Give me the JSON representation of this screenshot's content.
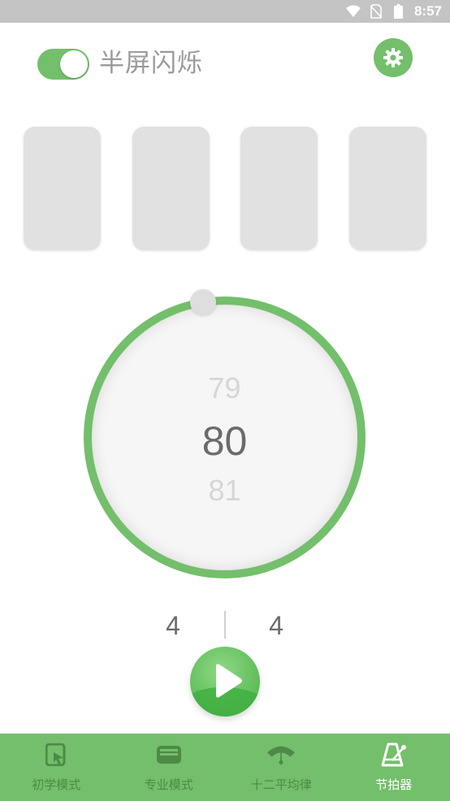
{
  "status_bar": {
    "time": "8:57",
    "icons": [
      "wifi-icon",
      "no-sim-icon",
      "battery-icon"
    ]
  },
  "header": {
    "flash_toggle_on": true,
    "flash_label": "半屏闪烁",
    "settings_icon": "gear-icon"
  },
  "beats": [
    {
      "active": false
    },
    {
      "active": false
    },
    {
      "active": false
    },
    {
      "active": false
    }
  ],
  "tempo": {
    "previous": "79",
    "current": "80",
    "next": "81"
  },
  "time_signature": {
    "beats_per_bar": "4",
    "note_value": "4"
  },
  "play_button": {
    "icon": "play-icon"
  },
  "nav": {
    "items": [
      {
        "label": "初学模式",
        "icon": "tablet-icon",
        "active": false
      },
      {
        "label": "专业模式",
        "icon": "card-icon",
        "active": false
      },
      {
        "label": "十二平均律",
        "icon": "fan-icon",
        "active": false
      },
      {
        "label": "节拍器",
        "icon": "metronome-icon",
        "active": true
      }
    ]
  },
  "colors": {
    "accent": "#73bf6b",
    "card": "#e1e1e1",
    "nav_inactive_text": "#4c8a46",
    "nav_active_text": "#ffffff"
  }
}
